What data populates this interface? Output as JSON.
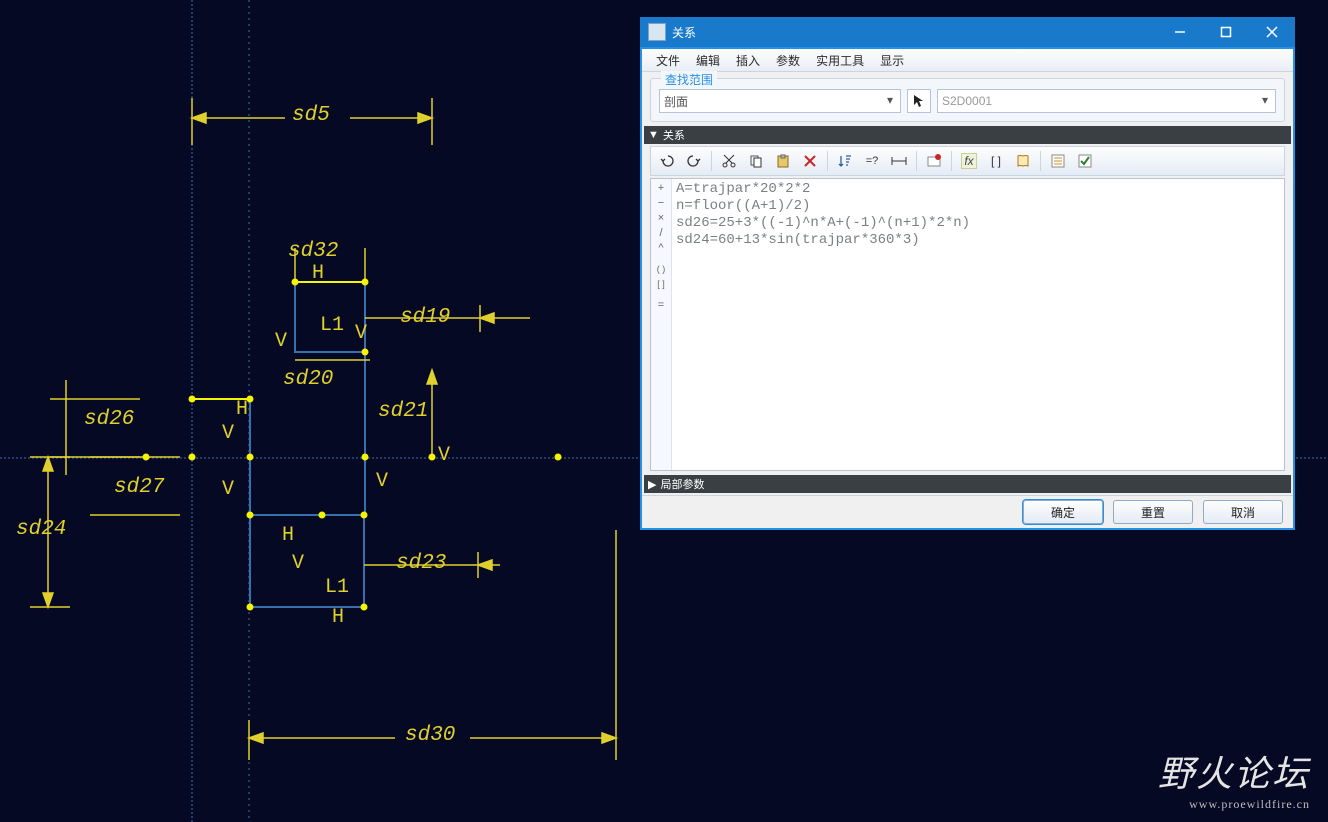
{
  "cad": {
    "dims": {
      "sd5": "sd5",
      "sd32": "sd32",
      "sd19": "sd19",
      "sd20": "sd20",
      "sd21": "sd21",
      "sd26": "sd26",
      "sd27": "sd27",
      "sd24": "sd24",
      "sd23": "sd23",
      "sd30": "sd30"
    },
    "constraints": {
      "H": "H",
      "V": "V",
      "L1": "L1",
      "L1b": "L1"
    }
  },
  "dialog": {
    "title": "关系",
    "menu": {
      "file": "文件",
      "edit": "编辑",
      "insert": "插入",
      "params": "参数",
      "tools": "实用工具",
      "show": "显示"
    },
    "scope": {
      "legend": "查找范围",
      "type": "剖面",
      "id": "S2D0001"
    },
    "section_relations": "关系",
    "section_local": "局部参数",
    "gutter": {
      "plus": "+",
      "minus": "−",
      "times": "×",
      "slash": "/",
      "caret": "^",
      "paren": "( )",
      "brack": "[ ]",
      "eq": "="
    },
    "code": "A=trajpar*20*2*2\nn=floor((A+1)/2)\nsd26=25+3*((-1)^n*A+(-1)^(n+1)*2*n)\nsd24=60+13*sin(trajpar*360*3)",
    "buttons": {
      "ok": "确定",
      "reset": "重置",
      "cancel": "取消"
    }
  },
  "watermark": {
    "text": "野火论坛",
    "url": "www.proewildfire.cn"
  }
}
